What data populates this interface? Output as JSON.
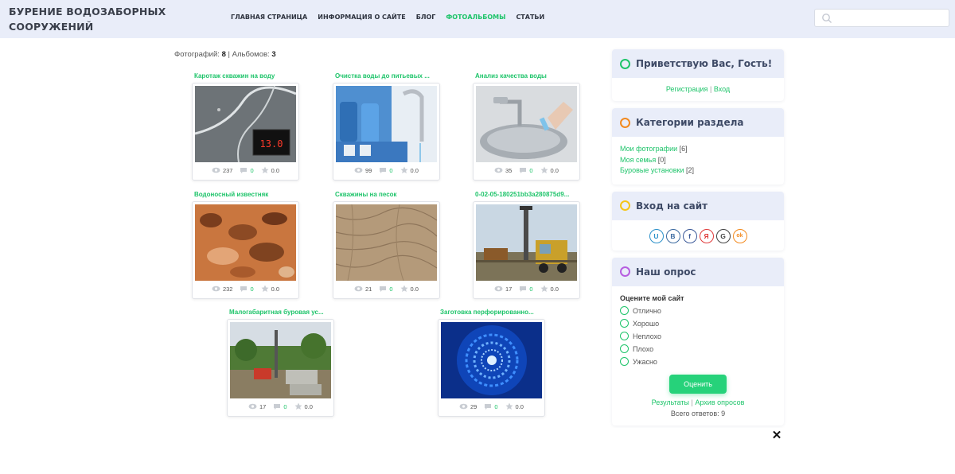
{
  "header": {
    "site_title": "БУРЕНИЕ ВОДОЗАБОРНЫХ СООРУЖЕНИЙ",
    "nav": [
      {
        "label": "ГЛАВНАЯ СТРАНИЦА",
        "active": false
      },
      {
        "label": "ИНФОРМАЦИЯ О САЙТЕ",
        "active": false
      },
      {
        "label": "БЛОГ",
        "active": false
      },
      {
        "label": "ФОТОАЛЬБОМЫ",
        "active": true
      },
      {
        "label": "СТАТЬИ",
        "active": false
      }
    ],
    "search": {
      "placeholder": "",
      "value": ""
    }
  },
  "stats": {
    "photos_label": "Фотографий:",
    "photos_count": "8",
    "separator": "|",
    "albums_label": "Альбомов:",
    "albums_count": "3"
  },
  "photos": [
    {
      "title": "Каротаж скважин на воду",
      "views": "237",
      "comments": "0",
      "rating": "0.0"
    },
    {
      "title": "Очистка воды до питьевых ...",
      "views": "99",
      "comments": "0",
      "rating": "0.0"
    },
    {
      "title": "Анализ качества воды",
      "views": "35",
      "comments": "0",
      "rating": "0.0"
    },
    {
      "title": "Водоносный известняк",
      "views": "232",
      "comments": "0",
      "rating": "0.0"
    },
    {
      "title": "Скважины на песок",
      "views": "21",
      "comments": "0",
      "rating": "0.0"
    },
    {
      "title": "0-02-05-180251bb3a280875d9...",
      "views": "17",
      "comments": "0",
      "rating": "0.0"
    },
    {
      "title": "Малогабаритная буровая ус...",
      "views": "17",
      "comments": "0",
      "rating": "0.0"
    },
    {
      "title": "Заготовка перфорированно...",
      "views": "29",
      "comments": "0",
      "rating": "0.0"
    }
  ],
  "sidebar": {
    "greeting": {
      "title": "Приветствую Вас, Гость!",
      "register": "Регистрация",
      "sep": "|",
      "login": "Вход",
      "ring_color": "#1ec46a"
    },
    "categories": {
      "title": "Категории раздела",
      "ring_color": "#f28a1f",
      "items": [
        {
          "label": "Мои фотографии",
          "count": "[6]"
        },
        {
          "label": "Моя семья",
          "count": "[0]"
        },
        {
          "label": "Буровые установки",
          "count": "[2]"
        }
      ]
    },
    "login": {
      "title": "Вход на сайт",
      "ring_color": "#f5c518",
      "socials": [
        {
          "letter": "U",
          "color": "#2b90c9"
        },
        {
          "letter": "B",
          "color": "#3c6aa0"
        },
        {
          "letter": "f",
          "color": "#3b5998"
        },
        {
          "letter": "Я",
          "color": "#e03a3a"
        },
        {
          "letter": "G",
          "color": "#444444"
        },
        {
          "letter": "ok",
          "color": "#f28a1f"
        }
      ]
    },
    "poll": {
      "title": "Наш опрос",
      "ring_color": "#b65de0",
      "question": "Оцените мой сайт",
      "options": [
        "Отлично",
        "Хорошо",
        "Неплохо",
        "Плохо",
        "Ужасно"
      ],
      "vote_label": "Оценить",
      "results": "Результаты",
      "sep": "|",
      "archive": "Архив опросов",
      "total": "Всего ответов: 9"
    }
  },
  "overlay": {
    "close_symbol": "✕"
  },
  "colors": {
    "accent": "#1ec46a",
    "header_bg": "#e9edf9",
    "heading": "#3e4a66"
  }
}
